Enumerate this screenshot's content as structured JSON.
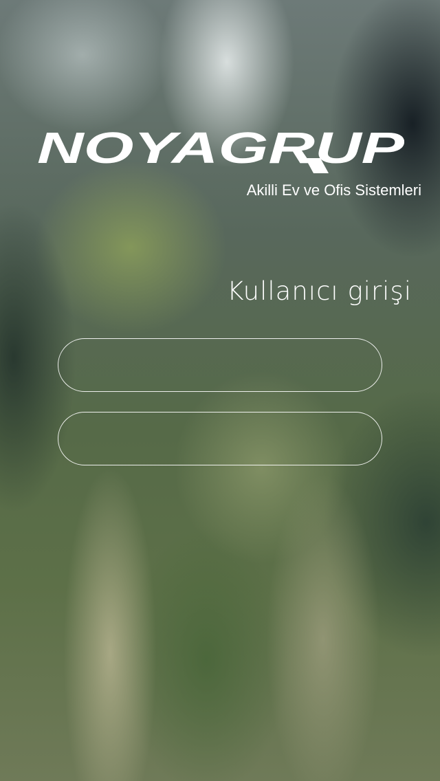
{
  "brand": {
    "logo_text": "NOYAGRUP",
    "tagline": "Akilli Ev ve Ofis Sistemleri"
  },
  "login": {
    "title": "Kullanıcı girişi",
    "username": {
      "value": "",
      "placeholder": ""
    },
    "password": {
      "value": "",
      "placeholder": ""
    }
  },
  "colors": {
    "text": "#ffffff",
    "field_border": "#ffffff"
  }
}
